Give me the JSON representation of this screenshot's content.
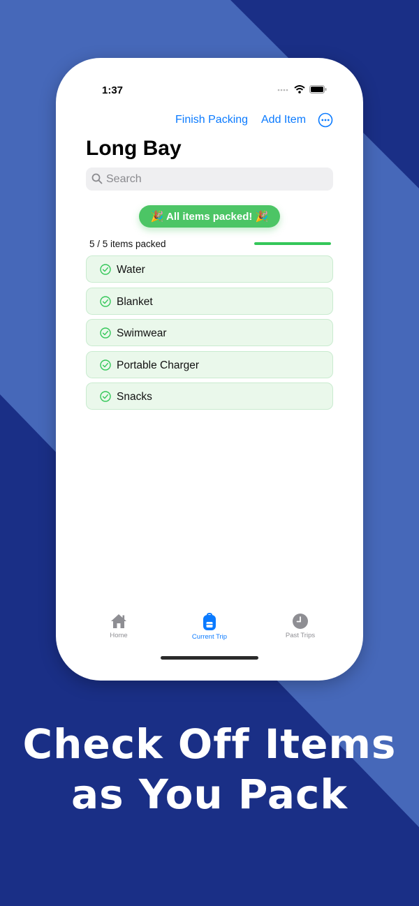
{
  "colors": {
    "background_dark": "#1a2f86",
    "background_light": "#4668b9",
    "accent": "#0a7aff",
    "success": "#34c759",
    "banner": "#4cc565"
  },
  "status_bar": {
    "time": "1:37"
  },
  "nav": {
    "finish_label": "Finish Packing",
    "add_label": "Add Item",
    "more_icon": "ellipsis-circle-icon"
  },
  "trip": {
    "title": "Long Bay"
  },
  "search": {
    "placeholder": "Search",
    "value": ""
  },
  "banner": {
    "text": "🎉 All items packed! 🎉"
  },
  "progress": {
    "text": "5 / 5 items packed",
    "packed": 5,
    "total": 5,
    "fraction": 1.0
  },
  "items": [
    {
      "label": "Water",
      "checked": true
    },
    {
      "label": "Blanket",
      "checked": true
    },
    {
      "label": "Swimwear",
      "checked": true
    },
    {
      "label": "Portable Charger",
      "checked": true
    },
    {
      "label": "Snacks",
      "checked": true
    }
  ],
  "tabs": [
    {
      "label": "Home",
      "icon": "house-icon",
      "active": false
    },
    {
      "label": "Current Trip",
      "icon": "backpack-icon",
      "active": true
    },
    {
      "label": "Past Trips",
      "icon": "clock-icon",
      "active": false
    }
  ],
  "caption": {
    "line1": "Check Off Items",
    "line2": "as You Pack"
  }
}
